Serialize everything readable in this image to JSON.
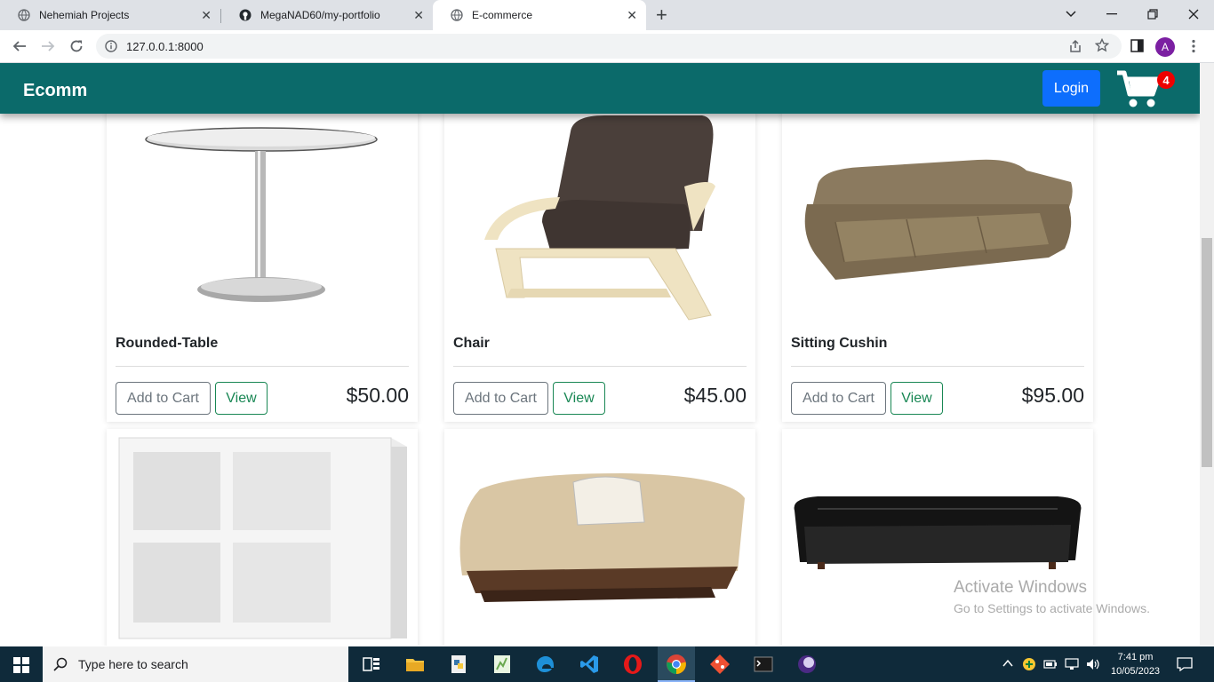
{
  "browser": {
    "tabs": [
      {
        "title": "Nehemiah Projects"
      },
      {
        "title": "MegaNAD60/my-portfolio"
      },
      {
        "title": "E-commerce"
      }
    ],
    "url": "127.0.0.1:8000"
  },
  "site": {
    "brand": "Ecomm",
    "login_label": "Login",
    "cart_count": "4"
  },
  "products": [
    {
      "name": "Rounded-Table",
      "price": "$50.00",
      "add_label": "Add to Cart",
      "view_label": "View"
    },
    {
      "name": "Chair",
      "price": "$45.00",
      "add_label": "Add to Cart",
      "view_label": "View"
    },
    {
      "name": "Sitting Cushin",
      "price": "$95.00",
      "add_label": "Add to Cart",
      "view_label": "View"
    }
  ],
  "watermark": {
    "line1": "Activate Windows",
    "line2": "Go to Settings to activate Windows."
  },
  "taskbar": {
    "search_placeholder": "Type here to search",
    "time": "7:41 pm",
    "date": "10/05/2023"
  },
  "colors": {
    "navbar": "#0b6a6a",
    "login": "#0d6efd",
    "badge": "#ee0000"
  }
}
